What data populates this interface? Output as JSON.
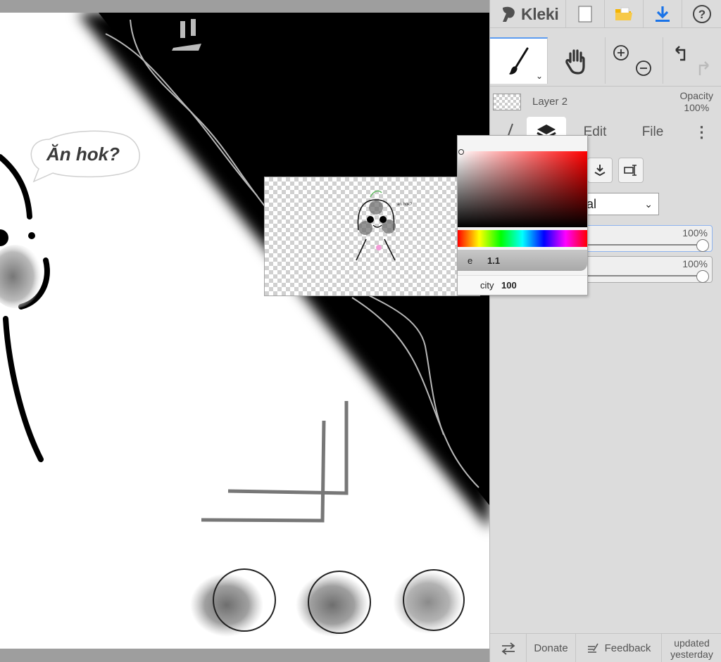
{
  "app": {
    "logo_text": "Kleki"
  },
  "topbar": {
    "icons": [
      "new-image-icon",
      "open-folder-icon",
      "download-icon",
      "help-icon"
    ],
    "help_glyph": "?"
  },
  "tools": {
    "active": "brush",
    "items": [
      "brush-tool",
      "hand-tool",
      "zoom-tool",
      "undo-redo"
    ]
  },
  "layer": {
    "name": "Layer 2",
    "opacity_label": "Opacity",
    "opacity_value": "100%"
  },
  "tabs": {
    "edit": "Edit",
    "file": "File",
    "more": "⋮"
  },
  "layers_panel": {
    "blend_mode": "al",
    "slider1_value": "100%",
    "slider2_value": "100%"
  },
  "footer": {
    "donate": "Donate",
    "feedback": "Feedback",
    "updated_line1": "updated",
    "updated_line2": "yesterday"
  },
  "color_picker": {
    "size_label": "e",
    "size_value": "1.1",
    "opacity_label": "city",
    "opacity_value": "100"
  },
  "canvas": {
    "speech_bubble": "Ăn hok?",
    "preview_tag": "an hok?"
  },
  "colors": {
    "accent": "#5c9cf0",
    "panel_bg": "#dcdcdc",
    "logo": "#505050",
    "folder": "#f4b400",
    "download": "#1a73e8"
  }
}
